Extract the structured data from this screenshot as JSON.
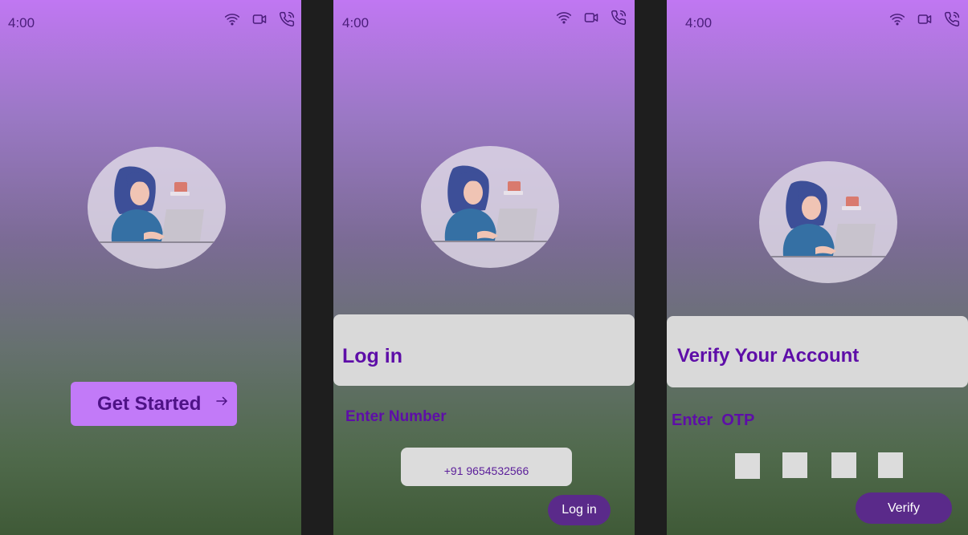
{
  "status_bar": {
    "time": "4:00",
    "icons": [
      "wifi-icon",
      "video-icon",
      "phone-call-icon"
    ]
  },
  "welcome": {
    "cta_label": "Get Started",
    "cta_icon": "arrow-right-icon"
  },
  "login": {
    "title": "Log in",
    "number_label": "Enter Number",
    "phone_value": "+91 9654532566",
    "button_label": "Log in"
  },
  "verify": {
    "title": "Verify Your Account",
    "otp_label": "Enter  OTP",
    "button_label": "Verify"
  },
  "colors": {
    "accent": "#c27af8",
    "text_primary": "#5e0ea8",
    "button_dark": "#5a2a8a",
    "panel": "#d9d9d9"
  }
}
